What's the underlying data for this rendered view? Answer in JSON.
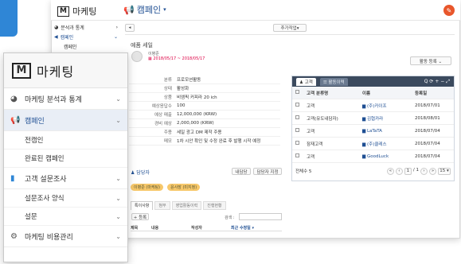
{
  "back": {
    "logo_text": "마케팅",
    "page_title": "캠페인",
    "title_caret": "▾",
    "edit_badge": "✎",
    "mini_menu": [
      {
        "icon": "◕",
        "label": "분석과 통계",
        "chev": "›"
      },
      {
        "icon": "◀",
        "label": "캠페인",
        "chev": "⌄"
      }
    ],
    "mini_sub": "캠페인",
    "add_button": "추가작업▾",
    "back_button": "◂",
    "campaign_name": "예품 세일",
    "owner": "이병준",
    "period": "2018/05/17 ~ 2018/05/17",
    "status_button": "활동 등록 ⌄",
    "details": [
      {
        "k": "분류",
        "v": "프로모션활동"
      },
      {
        "k": "상태",
        "v": "활성화"
      },
      {
        "k": "상품",
        "v": "비엠픽 커피라 20 ich"
      },
      {
        "k": "예상응답수",
        "v": "100"
      },
      {
        "k": "예상 매출",
        "v": "12,000,000 (KRW)"
      },
      {
        "k": "경비 예상",
        "v": "2,000,000 (KRW)"
      },
      {
        "k": "주용",
        "v": "세일 광고 DM 제작 주용"
      },
      {
        "k": "메모",
        "v": "1차 시안 확인 및 수정 완료 후 발행 시작 예정"
      }
    ],
    "assignee_label": "담당자",
    "assignee_buttons": [
      "내담당",
      "담당자 지정"
    ],
    "assignee_pills": [
      "이병준 (마케팅)",
      "윤사장 (미지정)"
    ],
    "tabs": [
      "특이사항",
      "첨부",
      "영업활동이력",
      "진행현황"
    ],
    "add_record": "+ 등록",
    "search_label": "검색 :",
    "list_headers": [
      "제목",
      "내용",
      "작성자",
      "최근 수정일 ▾"
    ],
    "table": {
      "tabs": [
        "고객",
        "활동이력"
      ],
      "controls": "Q  ⟳  +  −  ⤢",
      "headers": [
        "고객 분류명",
        "이름",
        "등록일"
      ],
      "rows": [
        {
          "type": "고객",
          "name": "(주)카이프",
          "date": "2018/07/01"
        },
        {
          "type": "고객(유도내담자)",
          "name": "김협카라",
          "date": "2018/08/01"
        },
        {
          "type": "고객",
          "name": "LaTaTA",
          "date": "2018/07/04"
        },
        {
          "type": "잠재고객",
          "name": "(주)클레스",
          "date": "2018/07/04"
        },
        {
          "type": "고객",
          "name": "GoodLuck",
          "date": "2018/07/04"
        }
      ],
      "total": "전체수 5",
      "pager": [
        "«",
        "‹",
        "1",
        "/ 1",
        "›",
        "»",
        "15 ▾"
      ]
    }
  },
  "front": {
    "logo_mark": "M",
    "logo_text": "마케팅",
    "menu": [
      {
        "icon": "◕",
        "label": "마케팅 분석과 통계",
        "chev": "⌄",
        "active": false
      },
      {
        "icon": "📢",
        "label": "캠페인",
        "chev": "⌄",
        "active": true
      }
    ],
    "campaign_sub": [
      "전캠인",
      "완료된 캠페인"
    ],
    "survey": {
      "icon": "▮",
      "label": "고객 설문조사",
      "chev": "⌄"
    },
    "survey_sub": [
      {
        "label": "설문조사 양식",
        "chev": "⌄"
      },
      {
        "label": "설문",
        "chev": "⌄"
      }
    ],
    "cost": {
      "icon": "⚙",
      "label": "마케팅 비용관리",
      "chev": "⌄"
    }
  }
}
